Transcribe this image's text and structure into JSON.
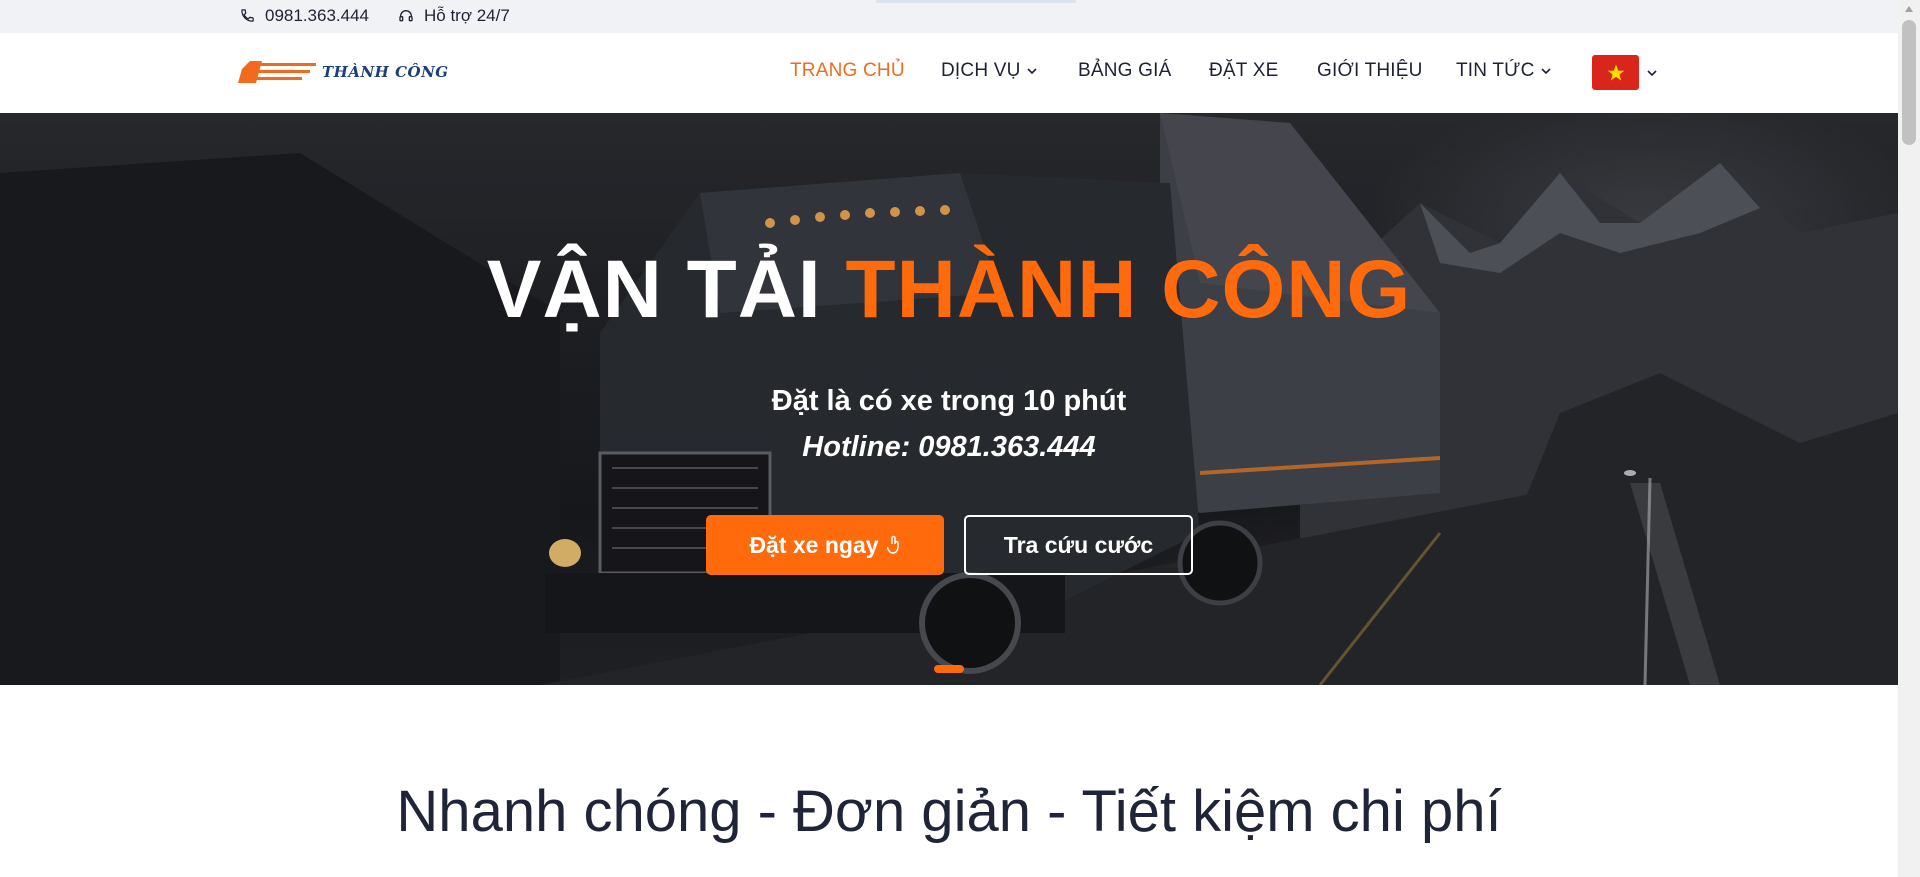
{
  "topbar": {
    "phone": "0981.363.444",
    "phone_icon": "phone-icon",
    "support": "Hỗ trợ 24/7",
    "support_icon": "headset-icon"
  },
  "header": {
    "logo_text": "THÀNH CÔNG",
    "nav": [
      {
        "label": "TRANG CHỦ",
        "active": true
      },
      {
        "label": "DỊCH VỤ",
        "dropdown": true
      },
      {
        "label": "BẢNG GIÁ"
      },
      {
        "label": "ĐẶT XE"
      },
      {
        "label": "GIỚI THIỆU"
      },
      {
        "label": "TIN TỨC",
        "dropdown": true
      }
    ],
    "language_icon": "vietnam-flag-icon"
  },
  "hero": {
    "title_white": "VẬN TẢI",
    "title_orange": "THÀNH CÔNG",
    "subtitle": "Đặt là có xe trong 10 phút",
    "hotline": "Hotline: 0981.363.444",
    "primary_button": "Đặt xe ngay",
    "primary_button_icon": "touch-icon",
    "secondary_button": "Tra cứu cước"
  },
  "section": {
    "title": "Nhanh chóng - Đơn giản - Tiết kiệm chi phí"
  },
  "colors": {
    "accent": "#ff6a0d",
    "nav_active": "#f26a1b",
    "text_dark": "#1f2235",
    "flag_red": "#da251d",
    "flag_star": "#ffde00"
  }
}
